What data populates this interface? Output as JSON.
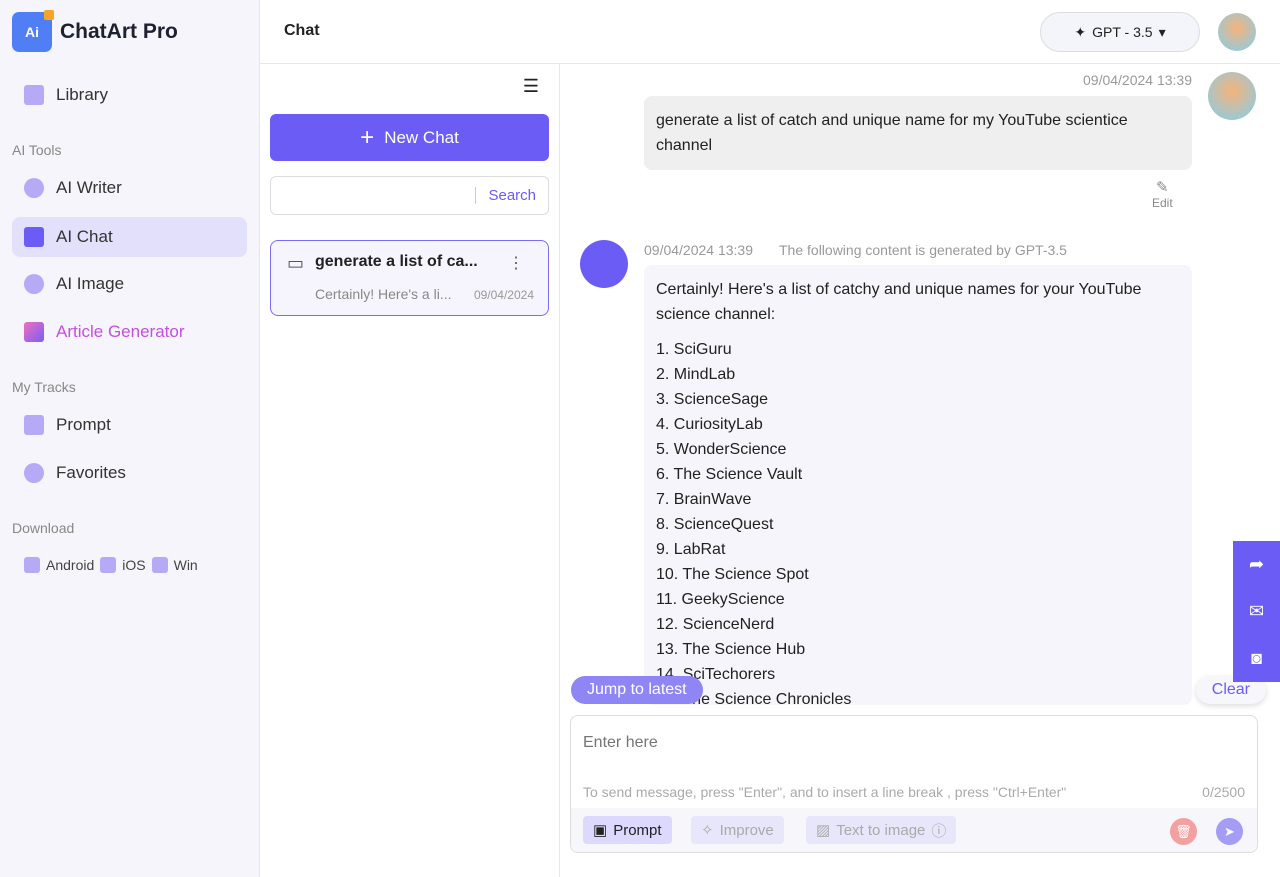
{
  "app": {
    "name": "ChatArt Pro",
    "logo_text": "Ai"
  },
  "sidebar": {
    "library": "Library",
    "sections": {
      "ai_tools": "AI Tools",
      "my_tracks": "My Tracks",
      "download": "Download"
    },
    "ai_tools": [
      {
        "label": "AI Writer"
      },
      {
        "label": "AI Chat",
        "active": true
      },
      {
        "label": "AI Image"
      },
      {
        "label": "Article Generator"
      }
    ],
    "tracks": [
      {
        "label": "Prompt"
      },
      {
        "label": "Favorites"
      }
    ],
    "downloads": [
      "Android",
      "iOS",
      "Win"
    ]
  },
  "header": {
    "title": "Chat",
    "model": "GPT - 3.5"
  },
  "chat_list": {
    "new_chat": "New Chat",
    "search_label": "Search",
    "search_value": "",
    "items": [
      {
        "title": "generate a list of ca...",
        "preview": "Certainly! Here's a li...",
        "date": "09/04/2024"
      }
    ]
  },
  "messages": {
    "user": {
      "time": "09/04/2024 13:39",
      "text": "generate a list of catch and unique name for my YouTube scientice channel",
      "edit": "Edit"
    },
    "bot": {
      "time": "09/04/2024 13:39",
      "note": "The following content is generated by GPT-3.5",
      "intro": "Certainly! Here's a list of catchy and unique names for your YouTube science channel:",
      "items": [
        "1. SciGuru",
        "2. MindLab",
        "3. ScienceSage",
        "4. CuriosityLab",
        "5. WonderScience",
        "6. The Science Vault",
        "7. BrainWave",
        "8. ScienceQuest",
        "9. LabRat",
        "10. The Science Spot",
        "11. GeekyScience",
        "12. ScienceNerd",
        "13. The Science Hub",
        "14. SciTechorers",
        "15. The Science Chronicles"
      ]
    }
  },
  "composer": {
    "jump": "Jump to latest",
    "clear": "Clear",
    "placeholder": "Enter here",
    "hint": "To send message, press \"Enter\", and to insert a line break , press \"Ctrl+Enter\"",
    "count": "0/2500",
    "prompt": "Prompt",
    "improve": "Improve",
    "text_to_image": "Text to image"
  },
  "colors": {
    "accent": "#6b5cf6",
    "article": "#c44fe0",
    "delete": "#f3a0a0"
  }
}
